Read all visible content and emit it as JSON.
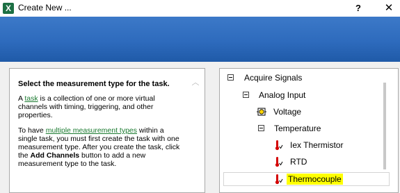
{
  "window": {
    "app_icon_letter": "X",
    "title": "Create New ...",
    "help_label": "?",
    "close_label": "✕"
  },
  "description": {
    "heading": "Select the measurement type for the task.",
    "p1_before": "A ",
    "p1_link": "task",
    "p1_after": " is a collection of one or more virtual channels with timing, triggering, and other properties.",
    "p2_before": "To have ",
    "p2_link": "multiple measurement types",
    "p2_middle": " within a single task, you must first create the task with one measurement type. After you create the task, click the ",
    "p2_bold": "Add Channels",
    "p2_after": " button to add a new measurement type to the task."
  },
  "tree": {
    "acquire_signals": "Acquire Signals",
    "analog_input": "Analog Input",
    "voltage": "Voltage",
    "temperature": "Temperature",
    "iex_thermistor": "Iex Thermistor",
    "rtd": "RTD",
    "thermocouple": "Thermocouple"
  },
  "colors": {
    "banner": "#2e6bbd",
    "link": "#1a7a2f",
    "highlight": "#ffff00",
    "thermometer": "#d40000"
  }
}
